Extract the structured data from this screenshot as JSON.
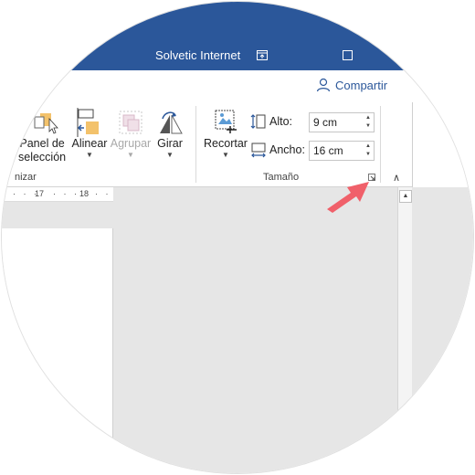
{
  "window": {
    "title": "Solvetic Internet",
    "share_label": "Compartir"
  },
  "ribbon": {
    "arrange": {
      "selection_pane_line1": "Panel de",
      "selection_pane_line2": "selección",
      "align": "Alinear",
      "group": "Agrupar",
      "rotate": "Girar",
      "group_label": "nizar"
    },
    "size": {
      "crop": "Recortar",
      "height_label": "Alto:",
      "height_value": "9 cm",
      "width_label": "Ancho:",
      "width_value": "16 cm",
      "group_label": "Tamaño"
    }
  },
  "ruler": {
    "marks": [
      "17",
      "18"
    ]
  },
  "colors": {
    "titlebar": "#2b579a",
    "doc_background": "#e6e6e6",
    "pointer_arrow": "#f0606a"
  },
  "icons": {
    "share": "person-icon",
    "restore": "restore-window-icon",
    "maximize": "maximize-icon",
    "pointer": "red-pointer-arrow"
  }
}
